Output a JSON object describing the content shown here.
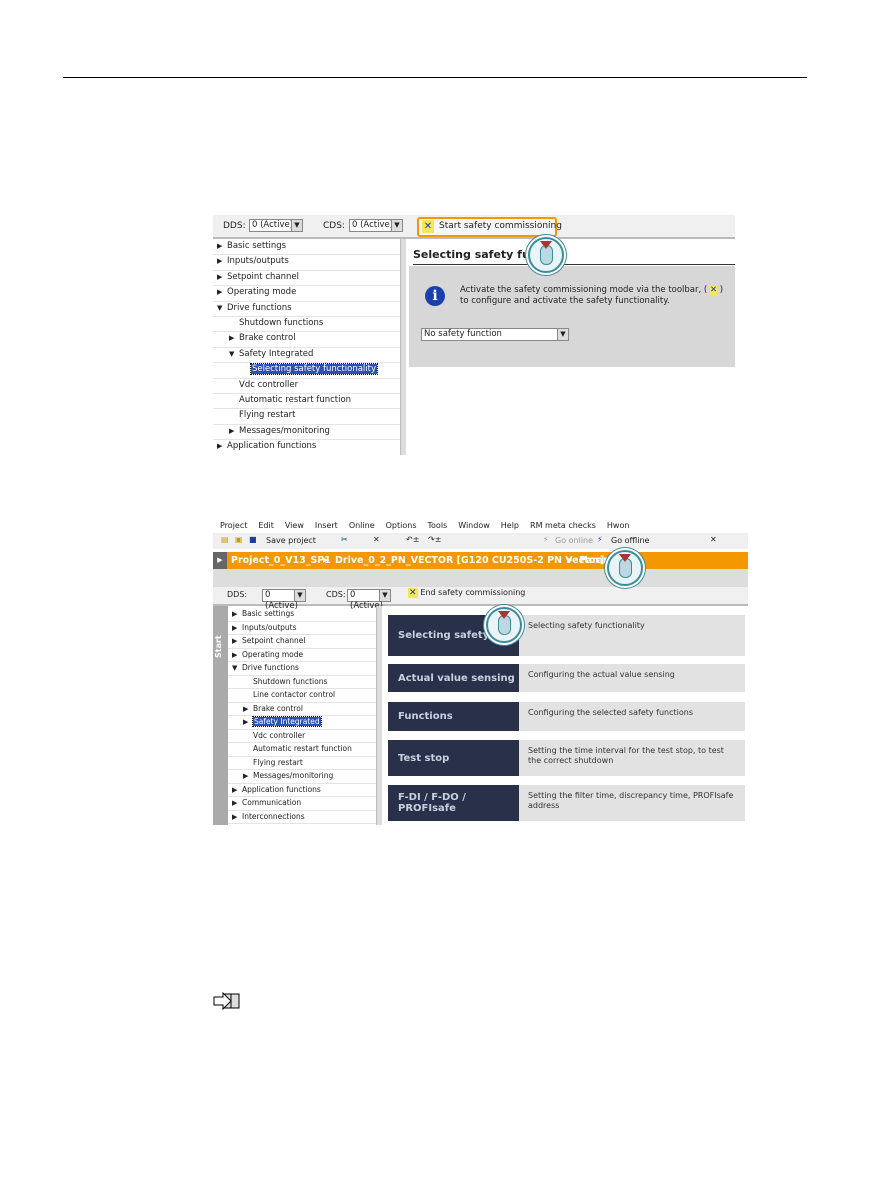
{
  "shot1": {
    "dds_label": "DDS:",
    "dds_value": "0 (Active)",
    "cds_label": "CDS:",
    "cds_value": "0 (Active)",
    "start_button": "Start safety commissioning",
    "heading": "Selecting safety functi",
    "info_text": "Activate the safety commissioning mode via the toolbar, (",
    "info_text_end": ")",
    "info_text2": "to configure and activate the safety functionality.",
    "dropdown_value": "No safety function",
    "tree": [
      {
        "label": "Basic settings",
        "level": 0,
        "state": "collapsed"
      },
      {
        "label": "Inputs/outputs",
        "level": 0,
        "state": "collapsed"
      },
      {
        "label": "Setpoint channel",
        "level": 0,
        "state": "collapsed"
      },
      {
        "label": "Operating mode",
        "level": 0,
        "state": "collapsed"
      },
      {
        "label": "Drive functions",
        "level": 0,
        "state": "expanded"
      },
      {
        "label": "Shutdown functions",
        "level": 1,
        "state": "leaf"
      },
      {
        "label": "Brake control",
        "level": 1,
        "state": "collapsed"
      },
      {
        "label": "Safety Integrated",
        "level": 1,
        "state": "expanded"
      },
      {
        "label": "Selecting safety functionality",
        "level": 2,
        "state": "selected"
      },
      {
        "label": "Vdc controller",
        "level": 1,
        "state": "leaf"
      },
      {
        "label": "Automatic restart function",
        "level": 1,
        "state": "leaf"
      },
      {
        "label": "Flying restart",
        "level": 1,
        "state": "leaf"
      },
      {
        "label": "Messages/monitoring",
        "level": 1,
        "state": "collapsed"
      },
      {
        "label": "Application functions",
        "level": 0,
        "state": "collapsed"
      }
    ]
  },
  "shot2": {
    "menu": [
      "Project",
      "Edit",
      "View",
      "Insert",
      "Online",
      "Options",
      "Tools",
      "Window",
      "Help",
      "RM meta checks",
      "Hwon"
    ],
    "save_project": "Save project",
    "go_online": "Go online",
    "go_offline": "Go offline",
    "breadcrumb": [
      "Project_0_V13_SP1",
      "Drive_0_2_PN_VECTOR [G120 CU250S-2 PN Vector]",
      "Parameter"
    ],
    "dds_label": "DDS:",
    "dds_value": "0 (Active)",
    "cds_label": "CDS:",
    "cds_value": "0 (Active)",
    "end_button": "End safety commissioning",
    "start_tab": "Start",
    "tree": [
      {
        "label": "Basic settings",
        "level": 0,
        "state": "collapsed"
      },
      {
        "label": "Inputs/outputs",
        "level": 0,
        "state": "collapsed"
      },
      {
        "label": "Setpoint channel",
        "level": 0,
        "state": "collapsed"
      },
      {
        "label": "Operating mode",
        "level": 0,
        "state": "collapsed"
      },
      {
        "label": "Drive functions",
        "level": 0,
        "state": "expanded"
      },
      {
        "label": "Shutdown functions",
        "level": 1,
        "state": "leaf"
      },
      {
        "label": "Line contactor control",
        "level": 1,
        "state": "leaf"
      },
      {
        "label": "Brake control",
        "level": 1,
        "state": "collapsed"
      },
      {
        "label": "Safety Integrated",
        "level": 1,
        "state": "selected"
      },
      {
        "label": "Vdc controller",
        "level": 1,
        "state": "leaf"
      },
      {
        "label": "Automatic restart function",
        "level": 1,
        "state": "leaf"
      },
      {
        "label": "Flying restart",
        "level": 1,
        "state": "leaf"
      },
      {
        "label": "Messages/monitoring",
        "level": 1,
        "state": "collapsed"
      },
      {
        "label": "Application functions",
        "level": 0,
        "state": "collapsed"
      },
      {
        "label": "Communication",
        "level": 0,
        "state": "collapsed"
      },
      {
        "label": "Interconnections",
        "level": 0,
        "state": "collapsed"
      }
    ],
    "cards": [
      {
        "title": "Selecting safety fu",
        "desc": "Selecting safety functionality"
      },
      {
        "title": "Actual value sensing",
        "desc": "Configuring the actual value sensing"
      },
      {
        "title": "Functions",
        "desc": "Configuring the selected safety functions"
      },
      {
        "title": "Test stop",
        "desc": "Setting the time interval for the test stop, to test the correct shutdown"
      },
      {
        "title": "F-DI / F-DO / PROFIsafe",
        "desc": "Setting the filter time, discrepancy time, PROFIsafe address"
      }
    ]
  },
  "colors": {
    "orange": "#f39800",
    "navy": "#283149",
    "selection": "#2952b8"
  },
  "icons": [
    "wrench-icon",
    "info-icon",
    "mouse-click-icon",
    "manual-reference-icon"
  ]
}
